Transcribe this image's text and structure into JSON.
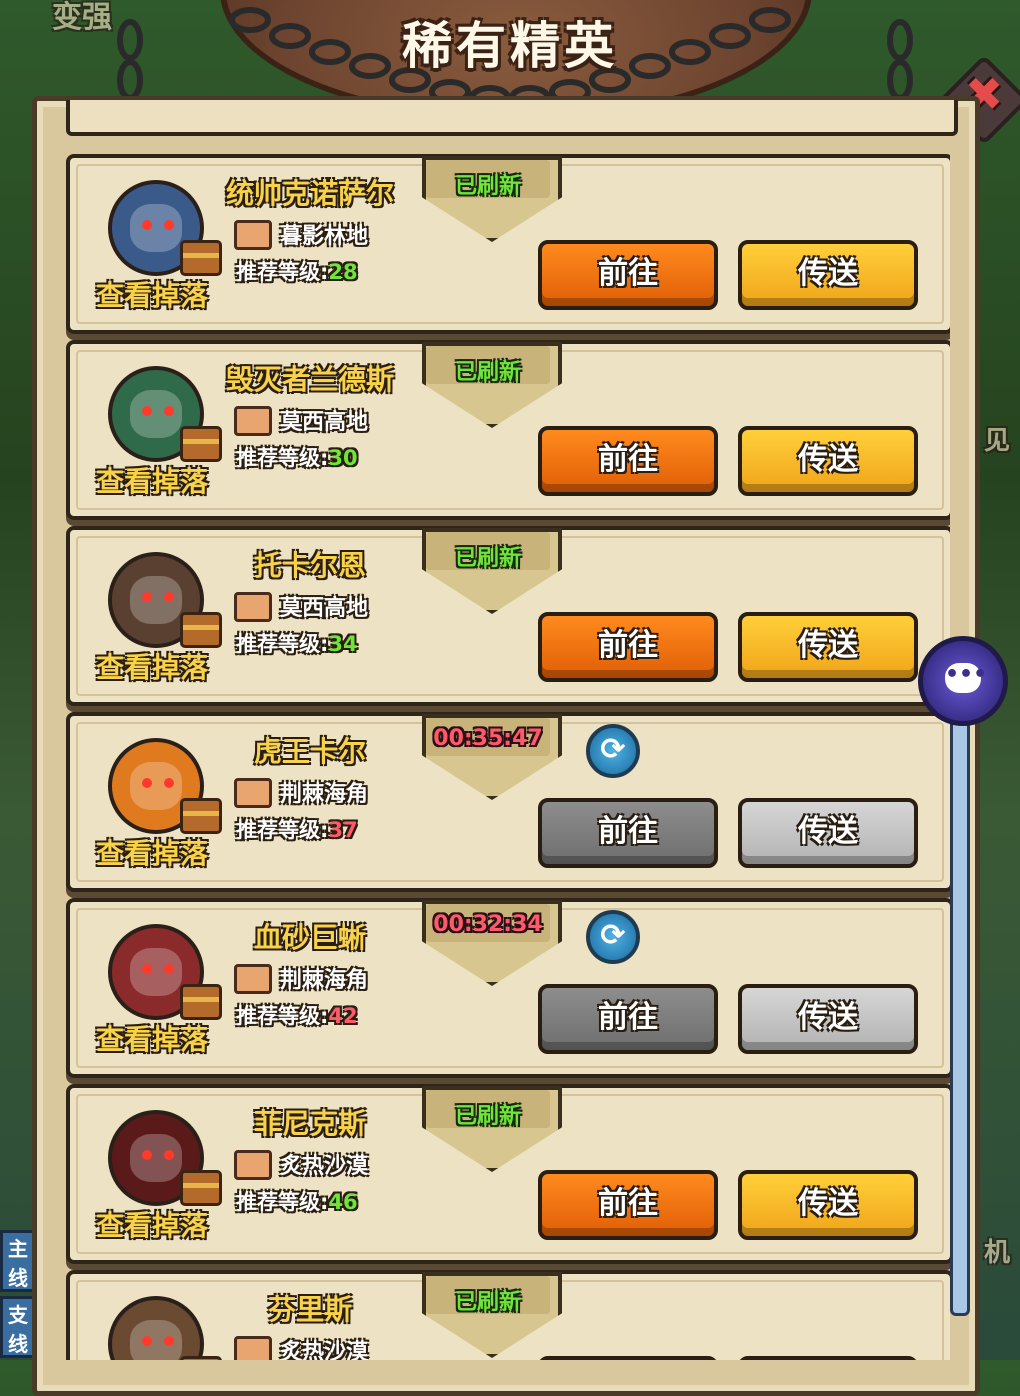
{
  "title": "稀有精英",
  "background_labels": {
    "top_left": "变强",
    "right_mid": "见",
    "right_bottom": "机"
  },
  "side_tabs": [
    "主线",
    "支线"
  ],
  "loot_label": "查看掉落",
  "level_label": "推荐等级:",
  "go_label": "前往",
  "teleport_label": "传送",
  "colors": {
    "accent_gold": "#f8d24a",
    "go_orange": "#ff8a1e",
    "teleport_yellow": "#ffcf3a",
    "refreshed_green": "#6fe53a",
    "timer_red": "#ff5a6a"
  },
  "bosses": [
    {
      "name": "统帅克诺萨尔",
      "location": "暮影林地",
      "level": "28",
      "status": "已刷新",
      "status_type": "refreshed",
      "avatar": "skull-warrior",
      "avatar_color": "#3a5a8a"
    },
    {
      "name": "毁灭者兰德斯",
      "location": "莫西高地",
      "level": "30",
      "status": "已刷新",
      "status_type": "refreshed",
      "avatar": "blue-haired-goblin",
      "avatar_color": "#2f6a4a"
    },
    {
      "name": "托卡尔恩",
      "location": "莫西高地",
      "level": "34",
      "status": "已刷新",
      "status_type": "refreshed",
      "avatar": "horned-beast",
      "avatar_color": "#5a4030"
    },
    {
      "name": "虎王卡尔",
      "location": "荆棘海角",
      "level": "37",
      "status": "00:35:47",
      "status_type": "timer",
      "avatar": "tiger-king",
      "avatar_color": "#e07a1e"
    },
    {
      "name": "血砂巨蜥",
      "location": "荆棘海角",
      "level": "42",
      "status": "00:32:34",
      "status_type": "timer",
      "avatar": "red-lizard",
      "avatar_color": "#8a2a2a"
    },
    {
      "name": "菲尼克斯",
      "location": "炙热沙漠",
      "level": "46",
      "status": "已刷新",
      "status_type": "refreshed",
      "avatar": "phoenix-bird",
      "avatar_color": "#5a1a1a"
    },
    {
      "name": "芬里斯",
      "location": "炙热沙漠",
      "level": "",
      "status": "已刷新",
      "status_type": "refreshed",
      "avatar": "werewolf",
      "avatar_color": "#6a4a30"
    }
  ]
}
